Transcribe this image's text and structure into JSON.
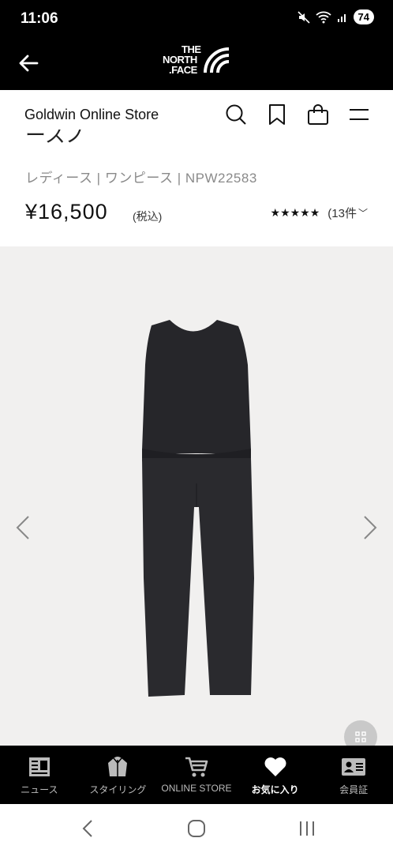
{
  "status_bar": {
    "time": "11:06",
    "battery": "74"
  },
  "header": {
    "logo_line1": "THE",
    "logo_line2": "NORTH",
    "logo_line3": ".FACE"
  },
  "store_bar": {
    "store_name": "Goldwin Online Store"
  },
  "product": {
    "partial_title": "ースノ",
    "category": "レディース | ワンピース | NPW22583",
    "price": "¥16,500",
    "tax_label": "(税込)",
    "stars": "★★★★★",
    "rating_value": 4.5,
    "review_count": "(13件",
    "review_chevron": "﹀"
  },
  "bottom_nav": [
    {
      "label": "ニュース",
      "icon": "news-icon"
    },
    {
      "label": "スタイリング",
      "icon": "styling-icon"
    },
    {
      "label": "ONLINE STORE",
      "icon": "cart-icon"
    },
    {
      "label": "お気に入り",
      "icon": "heart-icon",
      "active": true
    },
    {
      "label": "会員証",
      "icon": "member-card-icon"
    }
  ],
  "colors": {
    "bar": "#000000",
    "gallery_bg": "#f1f0ef",
    "garment": "#26262a"
  }
}
